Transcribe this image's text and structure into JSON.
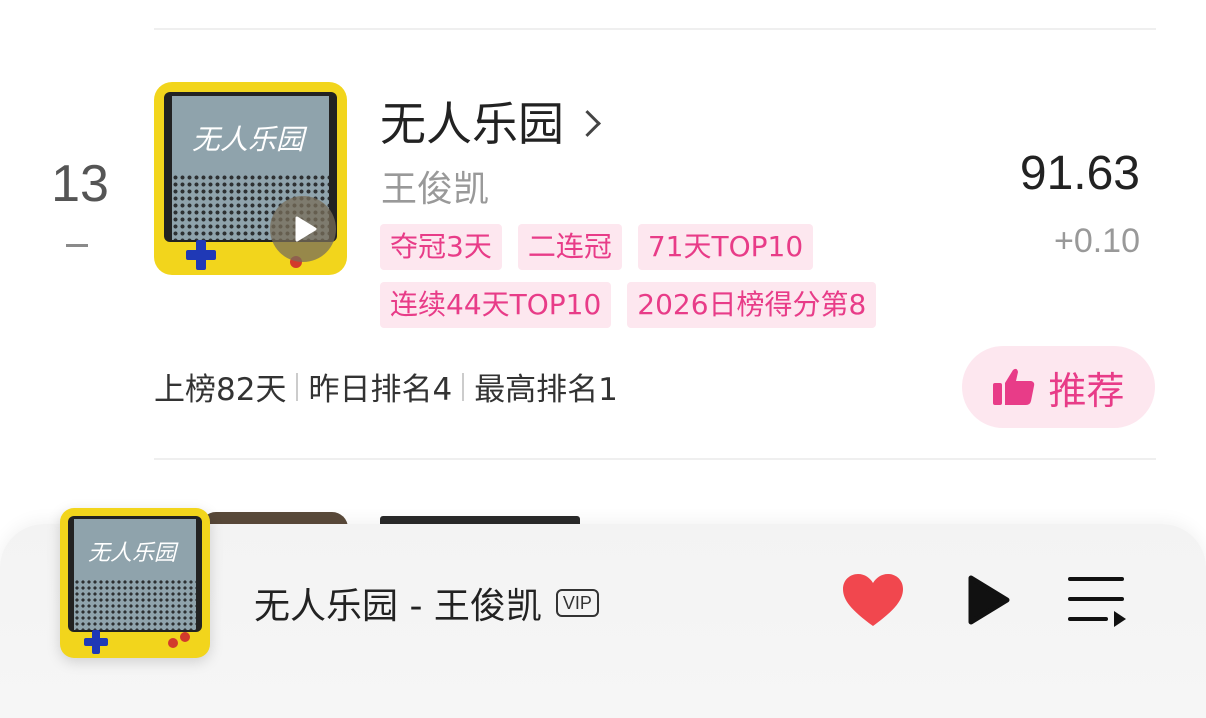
{
  "row": {
    "rank": "13",
    "title": "无人乐园",
    "artist": "王俊凯",
    "tags": [
      "夺冠3天",
      "二连冠",
      "71天TOP10",
      "连续44天TOP10",
      "2026日榜得分第8"
    ],
    "score": "91.63",
    "score_change": "+0.10",
    "stats": [
      "上榜82天",
      "昨日排名4",
      "最高排名1"
    ],
    "recommend_label": "推荐"
  },
  "player": {
    "now_playing": "无人乐园 - 王俊凯",
    "vip_label": "VIP"
  },
  "colors": {
    "accent": "#e83c88",
    "tag_bg": "#fde7ef",
    "like_heart": "#f1474e",
    "cover_yellow": "#f2d51c"
  }
}
